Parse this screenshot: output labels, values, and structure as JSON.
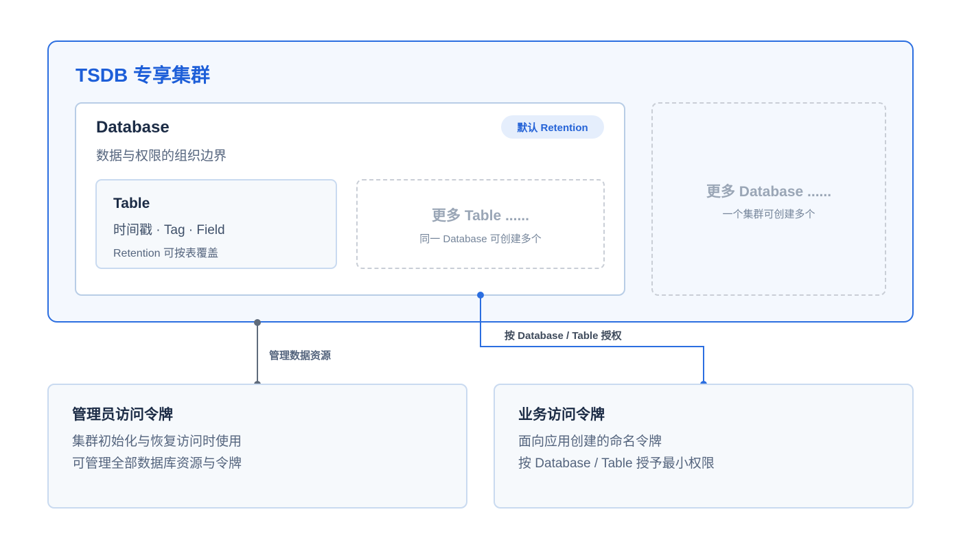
{
  "cluster": {
    "title": "TSDB 专享集群"
  },
  "database": {
    "title": "Database",
    "subtitle": "数据与权限的组织边界",
    "retention_badge": "默认 Retention",
    "table": {
      "title": "Table",
      "fields": "时间戳 · Tag · Field",
      "note": "Retention 可按表覆盖"
    },
    "more_table": {
      "title": "更多 Table ......",
      "subtitle": "同一 Database 可创建多个"
    }
  },
  "more_database": {
    "title": "更多 Database ......",
    "subtitle": "一个集群可创建多个"
  },
  "edges": {
    "admin_label": "管理数据资源",
    "business_label": "按 Database / Table 授权"
  },
  "admin_token": {
    "title": "管理员访问令牌",
    "lines": [
      "集群初始化与恢复访问时使用",
      "可管理全部数据库资源与令牌"
    ]
  },
  "business_token": {
    "title": "业务访问令牌",
    "lines": [
      "面向应用创建的命名令牌",
      "按 Database / Table 授予最小权限"
    ]
  },
  "colors": {
    "accent": "#2b6ee0",
    "admin_edge": "#5f6b7b",
    "business_edge": "#2b6ee0"
  }
}
